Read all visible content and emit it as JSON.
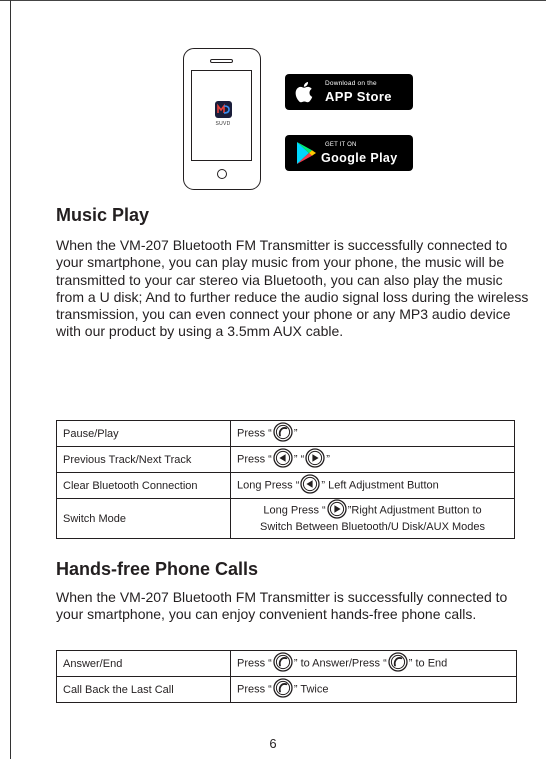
{
  "store_badges": {
    "apple": {
      "small": "Download on the",
      "big": "APP Store"
    },
    "google": {
      "small": "GET IT ON",
      "big": "Google Play"
    }
  },
  "phone": {
    "app_caption": "SUVD"
  },
  "music_play": {
    "title": "Music Play",
    "paragraph": "When the VM-207 Bluetooth FM Transmitter is successfully connected to your smartphone, you can play music from your phone, the music will be transmitted to your car stereo via Bluetooth, you can also play the music from a U disk; And to further reduce the audio signal loss during the wireless transmission, you can even connect your phone or any MP3 audio device with our product by using a 3.5mm AUX cable.",
    "rows": [
      {
        "function": "Pause/Play",
        "instruction_before": "Press “",
        "instruction_after": "”"
      },
      {
        "function": "Previous Track/Next Track",
        "instruction_before": "Press “",
        "instruction_mid": "” “",
        "instruction_after": "”"
      },
      {
        "function": "Clear Bluetooth Connection",
        "instruction_before": "Long Press “",
        "instruction_after": "” Left Adjustment Button"
      },
      {
        "function": "Switch Mode",
        "instruction_before": "Long Press “",
        "instruction_after": "”Right Adjustment Button to",
        "instruction_line2": "Switch Between Bluetooth/U Disk/AUX Modes"
      }
    ]
  },
  "hands_free": {
    "title": "Hands-free Phone Calls",
    "paragraph": "When the VM-207 Bluetooth FM Transmitter is successfully connected to your smartphone, you can enjoy convenient hands-free phone calls.",
    "rows": [
      {
        "function": "Answer/End",
        "instruction_before": "Press “",
        "instruction_mid": "” to Answer/Press “",
        "instruction_after": "” to End"
      },
      {
        "function": "Call Back the Last Call",
        "instruction_before": "Press “",
        "instruction_after": "” Twice"
      }
    ]
  },
  "page_number": "6",
  "icons": {
    "phone_button": "phone-button-icon",
    "prev_button": "prev-button-icon",
    "next_button": "next-button-icon",
    "apple": "apple-logo-icon",
    "google": "google-play-icon"
  },
  "colors": {
    "text": "#231f20",
    "badge": "#000000"
  }
}
